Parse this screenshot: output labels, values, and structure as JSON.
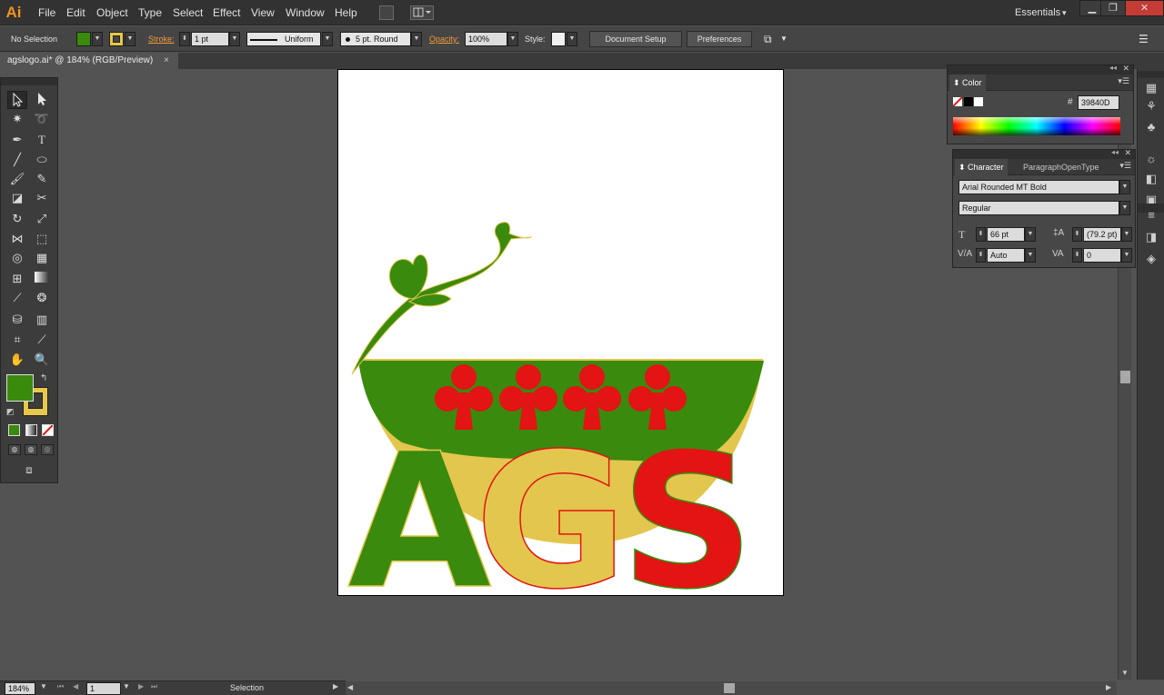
{
  "app": {
    "logo": "Ai",
    "workspace": "Essentials"
  },
  "menu": [
    "File",
    "Edit",
    "Object",
    "Type",
    "Select",
    "Effect",
    "View",
    "Window",
    "Help"
  ],
  "control_bar": {
    "selection_label": "No Selection",
    "fill_color": "#3a8a0d",
    "stroke_color": "#e8c84a",
    "stroke_label": "Stroke:",
    "stroke_weight": "1 pt",
    "profile": "Uniform",
    "brush": "5 pt. Round",
    "opacity_label": "Opacity:",
    "opacity": "100%",
    "style_label": "Style:",
    "document_setup": "Document Setup",
    "preferences": "Preferences"
  },
  "document_tab": {
    "title": "agslogo.ai* @ 184% (RGB/Preview)",
    "close": "×"
  },
  "tools": {
    "fill_color": "#3a8a0d",
    "stroke_color": "#e8c84a"
  },
  "status_bar": {
    "zoom": "184%",
    "page": "1",
    "tool": "Selection"
  },
  "color_panel": {
    "title": "Color",
    "hex_label": "#",
    "hex": "39840D"
  },
  "character_panel": {
    "tabs": [
      "Character",
      "Paragraph",
      "OpenType"
    ],
    "font_family": "Arial Rounded MT Bold",
    "font_style": "Regular",
    "font_size": "66 pt",
    "leading": "(79.2 pt)",
    "kerning": "Auto",
    "tracking": "0"
  },
  "artwork": {
    "text": "AGS",
    "letters": [
      "A",
      "G",
      "S"
    ],
    "green": "#3a8a0d",
    "yellow": "#e3c64d",
    "red": "#e21414"
  }
}
